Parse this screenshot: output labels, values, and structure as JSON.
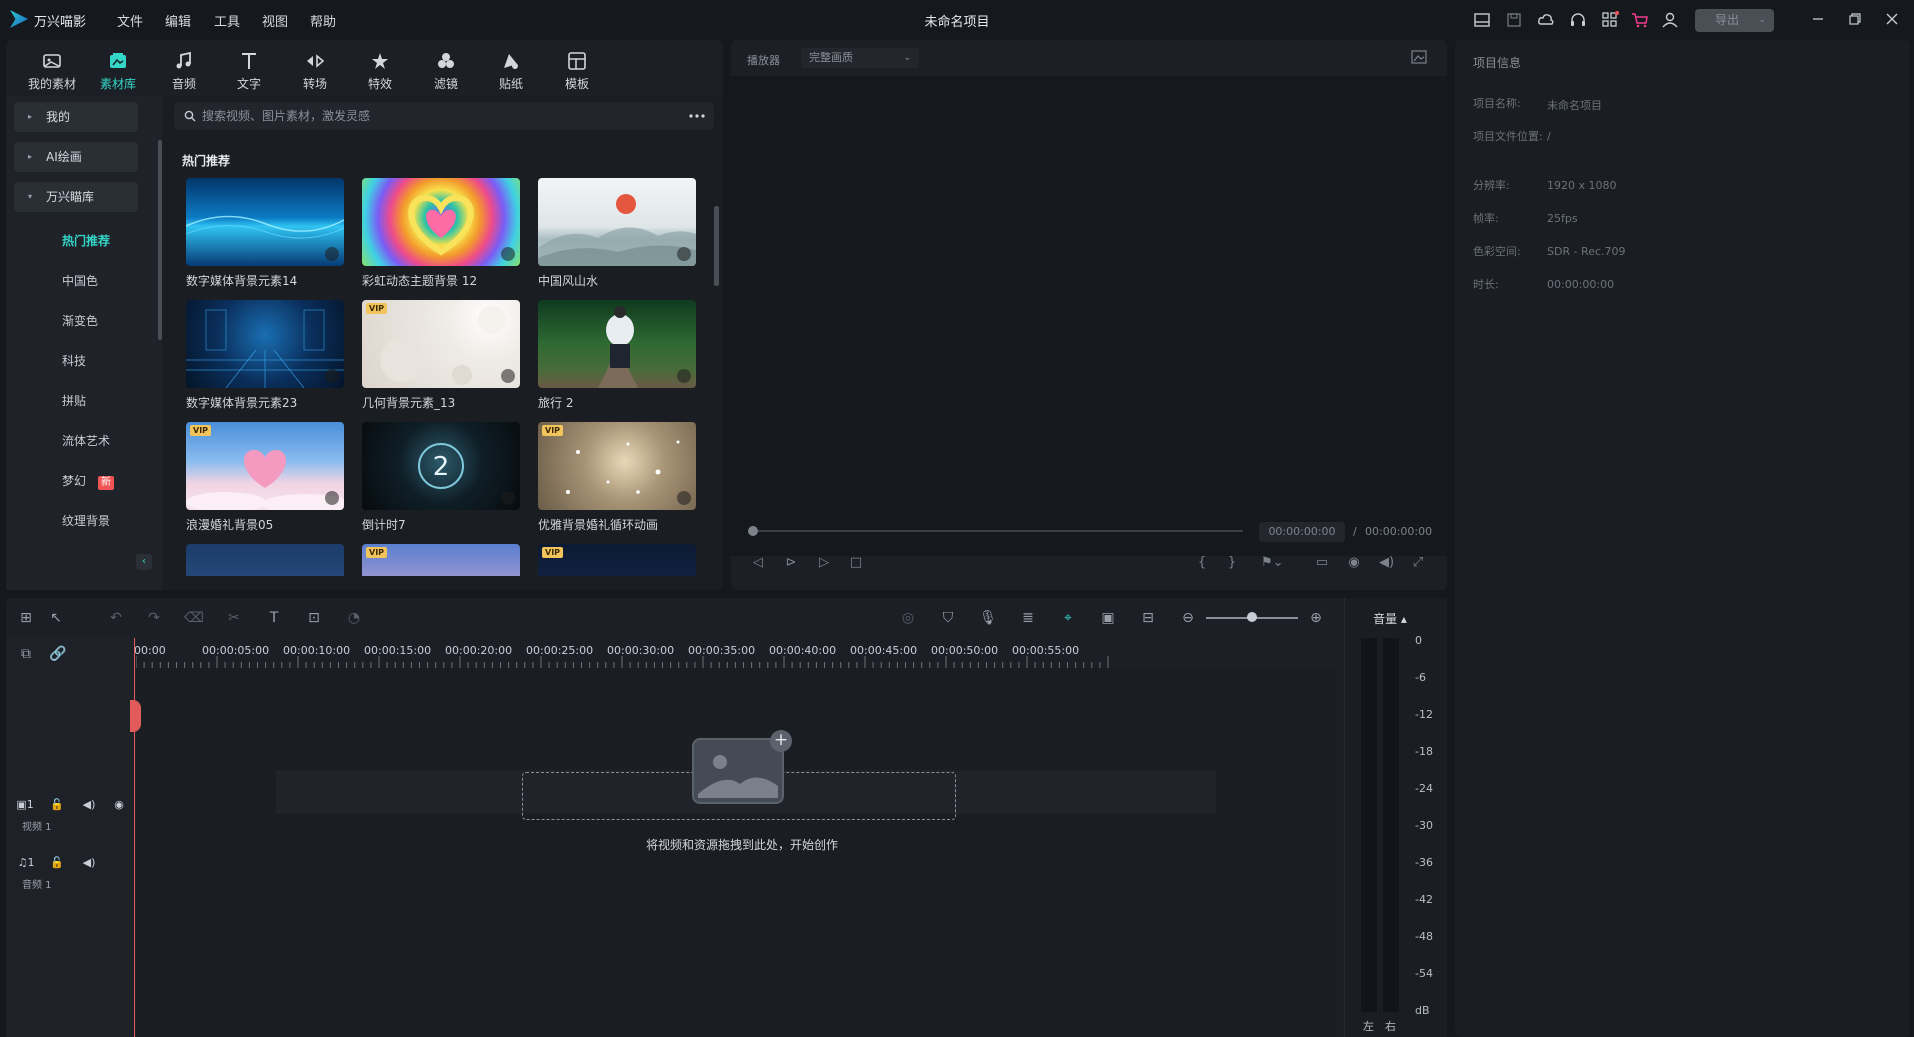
{
  "app": {
    "name": "万兴喵影",
    "project_title": "未命名项目"
  },
  "menu": [
    "文件",
    "编辑",
    "工具",
    "视图",
    "帮助"
  ],
  "titlebar": {
    "export_label": "导出"
  },
  "media_tabs": [
    {
      "label": "我的素材",
      "icon": "my-media-icon"
    },
    {
      "label": "素材库",
      "icon": "library-icon",
      "active": true
    },
    {
      "label": "音频",
      "icon": "music-note-icon"
    },
    {
      "label": "文字",
      "icon": "text-icon"
    },
    {
      "label": "转场",
      "icon": "transition-icon"
    },
    {
      "label": "特效",
      "icon": "effects-icon"
    },
    {
      "label": "滤镜",
      "icon": "filter-icon"
    },
    {
      "label": "贴纸",
      "icon": "sticker-icon"
    },
    {
      "label": "模板",
      "icon": "template-icon"
    }
  ],
  "sidebar": {
    "groups": [
      {
        "label": "我的",
        "expanded": false
      },
      {
        "label": "AI绘画",
        "expanded": false
      },
      {
        "label": "万兴瞄库",
        "expanded": true
      }
    ],
    "subitems": [
      {
        "label": "热门推荐",
        "active": true
      },
      {
        "label": "中国色"
      },
      {
        "label": "渐变色"
      },
      {
        "label": "科技"
      },
      {
        "label": "拼贴"
      },
      {
        "label": "流体艺术"
      },
      {
        "label": "梦幻",
        "badge": "新"
      },
      {
        "label": "纹理背景"
      }
    ]
  },
  "search": {
    "placeholder": "搜索视频、图片素材，激发灵感"
  },
  "library": {
    "section_title": "热门推荐",
    "items": [
      {
        "label": "数字媒体背景元素14",
        "vip": false
      },
      {
        "label": "彩虹动态主题背景 12",
        "vip": false
      },
      {
        "label": "中国风山水",
        "vip": false
      },
      {
        "label": "数字媒体背景元素23",
        "vip": false
      },
      {
        "label": "几何背景元素_13",
        "vip": true
      },
      {
        "label": "旅行 2",
        "vip": false
      },
      {
        "label": "浪漫婚礼背景05",
        "vip": true
      },
      {
        "label": "倒计时7",
        "vip": false
      },
      {
        "label": "优雅背景婚礼循环动画",
        "vip": true
      },
      {
        "label": "",
        "vip": false
      },
      {
        "label": "",
        "vip": true
      },
      {
        "label": "",
        "vip": true
      }
    ],
    "vip_label": "VIP"
  },
  "player": {
    "label": "播放器",
    "quality": "完整画质",
    "current_time": "00:00:00:00",
    "separator": "/",
    "total_time": "00:00:00:00",
    "progress": 0
  },
  "project_info": {
    "title": "项目信息",
    "fields": [
      {
        "label": "项目名称:",
        "value": "未命名项目"
      },
      {
        "label": "项目文件位置:",
        "value": "/"
      },
      {
        "label": "分辨率:",
        "value": "1920 x 1080"
      },
      {
        "label": "帧率:",
        "value": "25fps"
      },
      {
        "label": "色彩空间:",
        "value": "SDR - Rec.709"
      },
      {
        "label": "时长:",
        "value": "00:00:00:00"
      }
    ]
  },
  "timeline": {
    "ruler": [
      "00:00",
      "00:00:05:00",
      "00:00:10:00",
      "00:00:15:00",
      "00:00:20:00",
      "00:00:25:00",
      "00:00:30:00",
      "00:00:35:00",
      "00:00:40:00",
      "00:00:45:00",
      "00:00:50:00",
      "00:00:55:00"
    ],
    "tracks": [
      {
        "name": "视频 1",
        "number": "1",
        "type": "video"
      },
      {
        "name": "音频 1",
        "number": "1",
        "type": "audio"
      }
    ],
    "drop_hint": "将视频和资源拖拽到此处，开始创作",
    "zoom": 0.5
  },
  "volume": {
    "label": "音量",
    "scale": [
      "0",
      "-6",
      "-12",
      "-18",
      "-24",
      "-30",
      "-36",
      "-42",
      "-48",
      "-54",
      "dB"
    ],
    "left": "左",
    "right": "右"
  },
  "colors": {
    "accent": "#34d6c8",
    "playhead": "#e25b5b",
    "vip": "#f2c55c"
  }
}
